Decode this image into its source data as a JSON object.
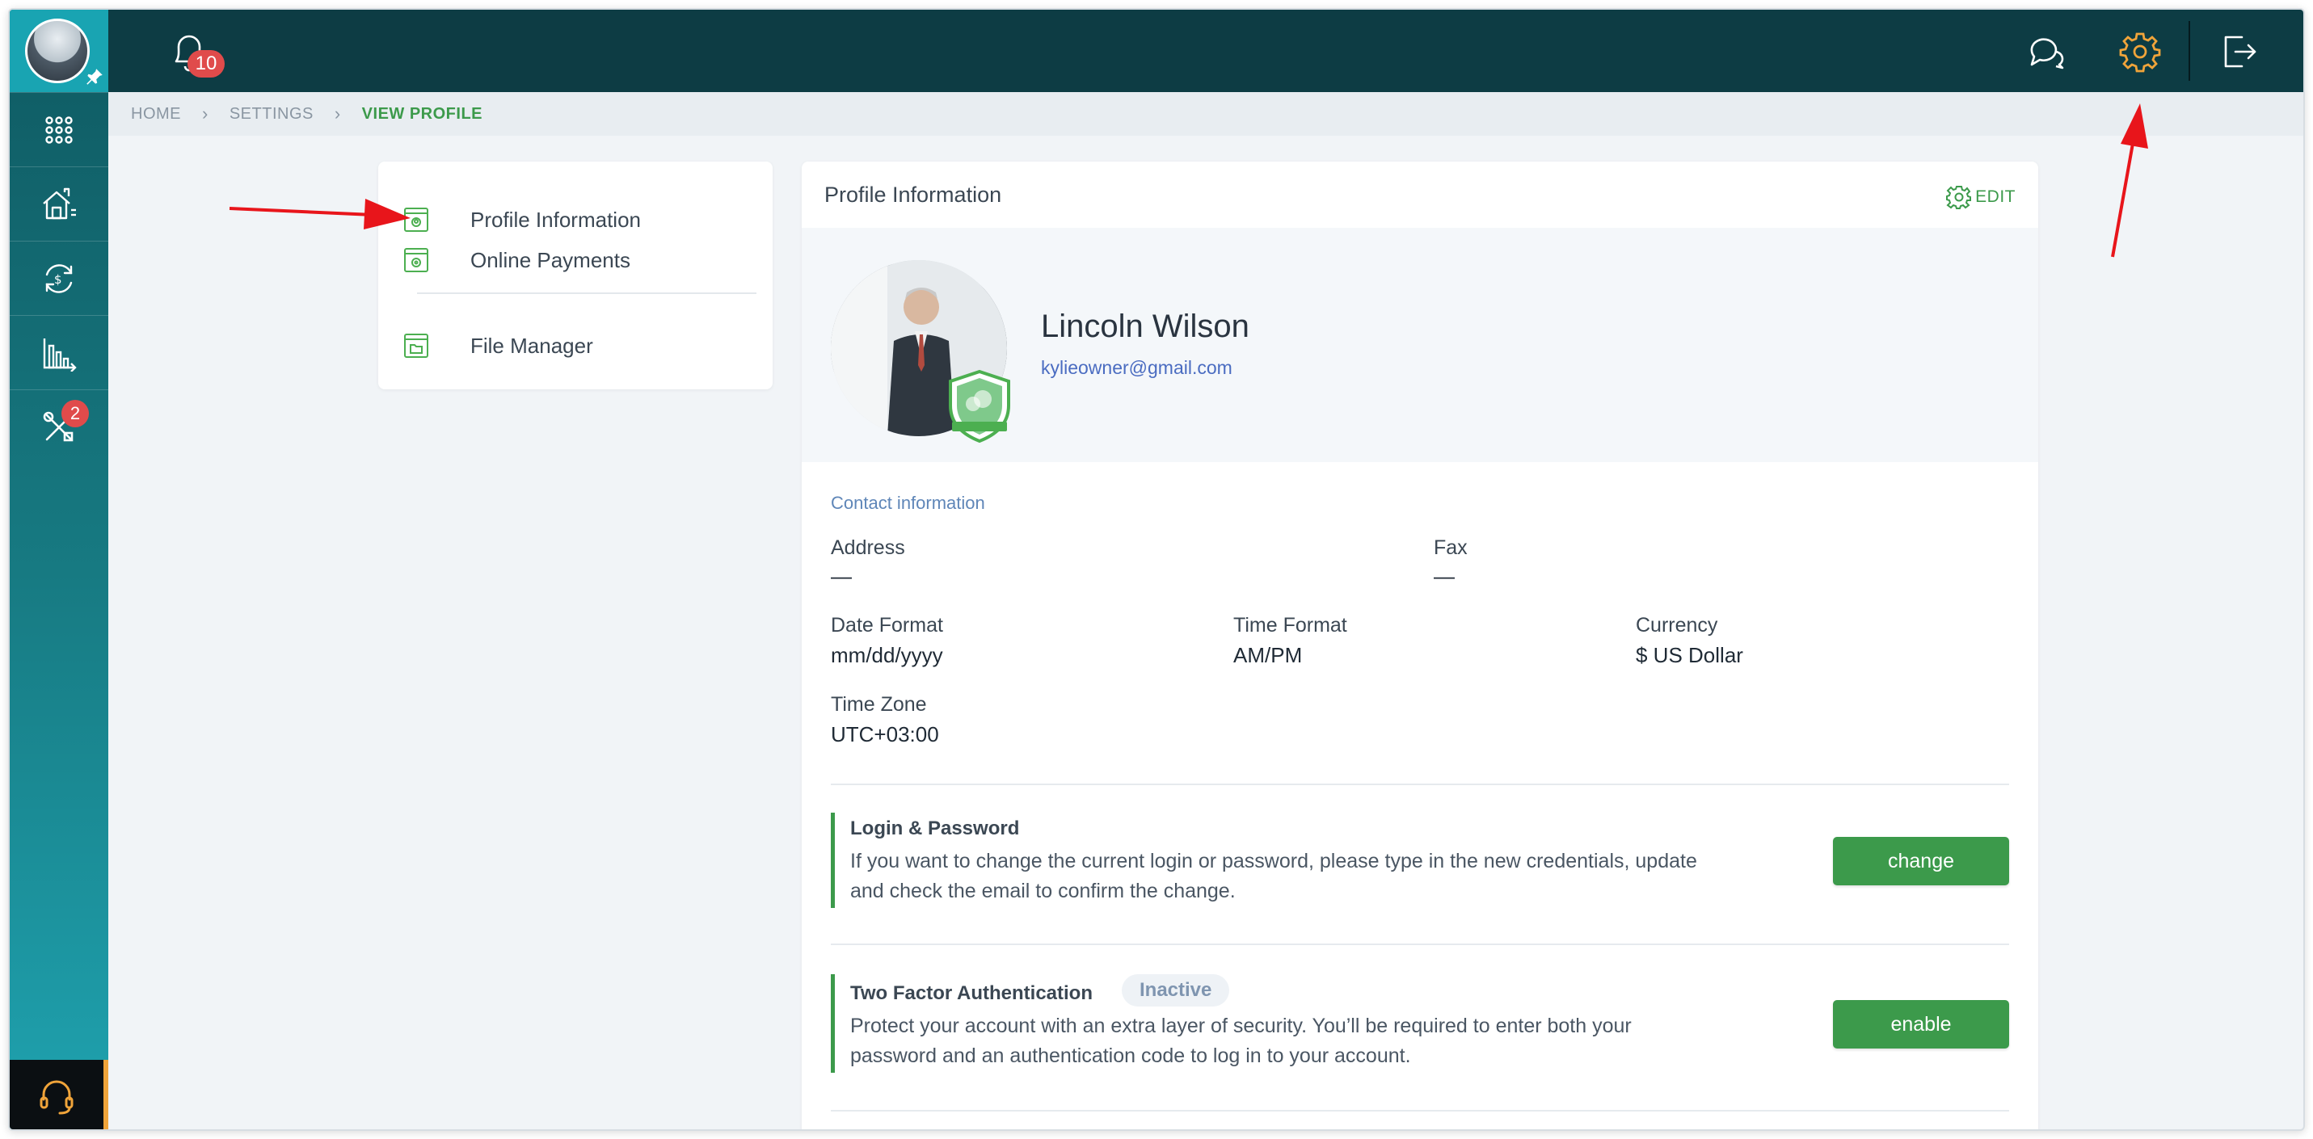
{
  "topbar": {
    "notifications_count": "10"
  },
  "rail": {
    "tools_badge": "2"
  },
  "breadcrumb": {
    "items": [
      "HOME",
      "SETTINGS",
      "VIEW PROFILE"
    ]
  },
  "menu": {
    "items": [
      {
        "label": "Profile Information"
      },
      {
        "label": "Online Payments"
      },
      {
        "label": "File Manager"
      }
    ]
  },
  "profile": {
    "card_title": "Profile Information",
    "edit_label": "EDIT",
    "name": "Lincoln Wilson",
    "email": "kylieowner@gmail.com",
    "contact_label": "Contact information",
    "fields": {
      "address": {
        "label": "Address",
        "value": "—"
      },
      "fax": {
        "label": "Fax",
        "value": "—"
      },
      "date_format": {
        "label": "Date Format",
        "value": "mm/dd/yyyy"
      },
      "time_format": {
        "label": "Time Format",
        "value": "AM/PM"
      },
      "currency": {
        "label": "Currency",
        "value": "$ US Dollar"
      },
      "time_zone": {
        "label": "Time Zone",
        "value": "UTC+03:00"
      }
    },
    "login": {
      "title": "Login & Password",
      "text": "If you want to change the current login or password, please type in the new credentials, update and check the email to confirm the change.",
      "button": "change"
    },
    "two_factor": {
      "title": "Two Factor Authentication",
      "status": "Inactive",
      "text": "Protect your account with an extra layer of security. You’ll be required to enter both your password and an authentication code to log in to your account.",
      "button": "enable"
    }
  },
  "colors": {
    "topbar": "#0d3c44",
    "accent_green": "#3c9a4b",
    "badge_red": "#e04b4b",
    "settings_icon": "#f0a43a",
    "link_blue": "#4a6cc1"
  }
}
